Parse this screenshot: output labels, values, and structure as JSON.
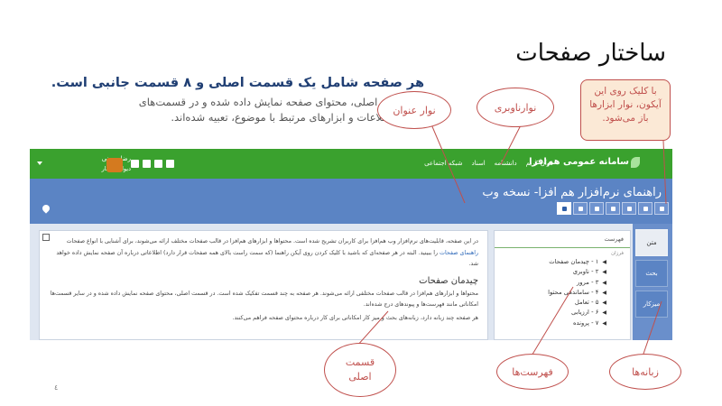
{
  "slide": {
    "title": "ساختار صفحات",
    "intro_bold": "هر صفحه شامل یک قسمت اصلی و ۸ قسمت جانبی است.",
    "intro_body": "در قسمت اصلی، محتوای صفحه نمایش داده شده و در قسمت‌های جانبی، اطلاعات و ابزارهای مرتبط با موضوع، تعبیه شده‌اند.",
    "page_number": "٤"
  },
  "callouts": {
    "title_bar": "نوار عنوان",
    "nav_bar": "نوارناوبری",
    "tip": "با کلیک روی این آیکون، نوار ابزارها باز می‌شود.",
    "main_part": "قسمت اصلی",
    "lists": "فهرست‌ها",
    "tabs": "زبانه‌ها"
  },
  "app": {
    "brand": "سامانه عمومی هم‌افزا",
    "nav_items": [
      "قرآن کریم",
      "دانشنامه",
      "اسناد",
      "شبکه اجتماعی"
    ],
    "user_name": "رضا حسنی",
    "user_sub": "دیوار      میزکار",
    "doc_title": "راهنمای نرم‌افزار هم افزا- نسخه وب",
    "main": {
      "p1_a": "در این صفحه، قابلیت‌های نرم‌افزار وب هم‌افزا برای کاربران تشریح شده است. محتواها و ابزارهای هم‌افزا در قالب صفحات مختلف ارائه می‌شوند، برای آشنایی با انواع صفحات",
      "p1_link": "راهنمای صفحات",
      "p1_b": "را ببینید. البته در هر صفحه‌ای که باشید با کلیک کردن روی آیکن راهنما (که سمت راست بالای همه صفحات قرار دارد) اطلاعاتی درباره آن صفحه نمایش داده خواهد شد.",
      "heading": "چیدمان صفحات",
      "p2": "محتواها و ابزارهای هم‌افزا در قالب صفحات مختلفی ارائه می‌شوند. هر صفحه به چند قسمت تفکیک شده است. در قسمت اصلی، محتوای صفحه نمایش داده شده و در سایر قسمت‌ها امکاناتی مانند فهرست‌ها و پیوندهای درج شده‌اند.",
      "p3": "هر صفحه چند زبانه دارد، زبانه‌های بحث و میز کار امکاناتی برای کار درباره محتوای صفحه فراهم می‌کنند."
    },
    "side": {
      "heading": "فهرست",
      "sub": "فرزان",
      "toc": [
        "۱ - چیدمان صفحات",
        "۲ - ناوبری",
        "۳ - مرور",
        "۴ - ساماندهی محتوا",
        "۵ - تعامل",
        "۶ - ارزیابی",
        "۷ - پرونده"
      ]
    },
    "tabs": [
      "متن",
      "بحث",
      "میزکار"
    ]
  },
  "colors": {
    "topbar": "#3aa12e",
    "titlebar": "#5b84c4",
    "callout": "#c0504d",
    "tip_fill": "#fbe9d6"
  }
}
